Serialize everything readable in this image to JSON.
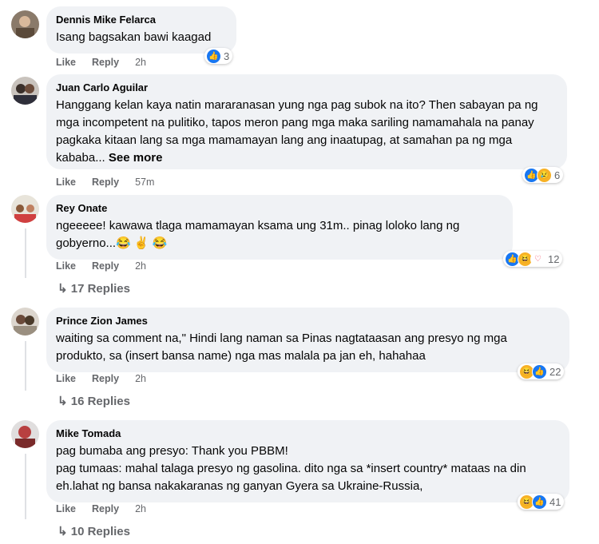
{
  "comments": [
    {
      "name": "Dennis Mike Felarca",
      "text": "Isang bagsakan bawi kaagad",
      "like": "Like",
      "reply": "Reply",
      "time": "2h",
      "reaction_count": "3",
      "replies": ""
    },
    {
      "name": "Juan Carlo Aguilar",
      "text": "Hanggang kelan kaya natin mararanasan yung nga pag subok na ito? Then sabayan pa ng mga incompetent na pulitiko, tapos meron pang mga maka sariling namamahala na panay pagkaka kitaan lang sa mga mamamayan lang ang inaatupag, at samahan pa ng mga kababa...",
      "see_more": "See more",
      "like": "Like",
      "reply": "Reply",
      "time": "57m",
      "reaction_count": "6",
      "replies": ""
    },
    {
      "name": "Rey Onate",
      "text": "ngeeeee! kawawa tlaga mamamayan ksama ung 31m.. pinag loloko lang ng gobyerno...😂 ✌ 😂",
      "like": "Like",
      "reply": "Reply",
      "time": "2h",
      "reaction_count": "12",
      "replies": "17 Replies"
    },
    {
      "name": "Prince Zion James",
      "text": "waiting sa comment na,\" Hindi lang naman sa Pinas nagtataasan ang presyo ng mga produkto, sa (insert bansa name) nga mas malala pa jan eh, hahahaa",
      "like": "Like",
      "reply": "Reply",
      "time": "2h",
      "reaction_count": "22",
      "replies": "16 Replies"
    },
    {
      "name": "Mike Tomada",
      "text": "pag bumaba ang presyo: Thank you PBBM!\npag tumaas: mahal talaga presyo ng gasolina. dito nga sa *insert country* mataas na din eh.lahat ng bansa nakakaranas ng ganyan Gyera sa Ukraine-Russia,",
      "like": "Like",
      "reply": "Reply",
      "time": "2h",
      "reaction_count": "41",
      "replies": "10 Replies"
    }
  ],
  "reply_arrow": "↳",
  "colors": {
    "bubble": "#f0f2f5",
    "like_blue": "#1877f2",
    "meta_gray": "#65676b"
  }
}
